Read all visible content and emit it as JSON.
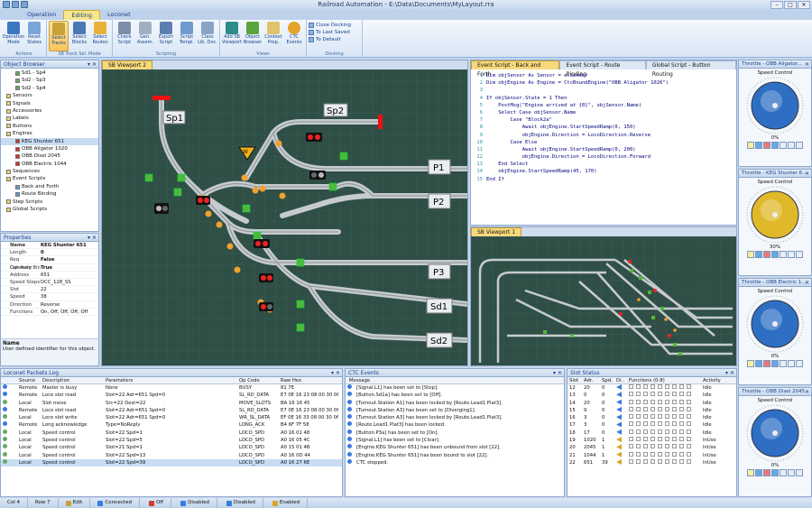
{
  "window": {
    "title": "Railroad Automation - E:\\Data\\Documents\\MyLayout.rra"
  },
  "tabs": [
    "Operation",
    "Editing",
    "Loconet"
  ],
  "ribbon": {
    "groups": [
      {
        "label": "Actions",
        "buttons": [
          {
            "l1": "Operation",
            "l2": "Mode"
          },
          {
            "l1": "Reset",
            "l2": "States"
          }
        ]
      },
      {
        "label": "SB Track Sel. Mode",
        "buttons": [
          {
            "l1": "Select",
            "l2": "Tracks"
          },
          {
            "l1": "Select",
            "l2": "Blocks"
          },
          {
            "l1": "Select",
            "l2": "Routes"
          }
        ]
      },
      {
        "label": "Scripting",
        "buttons": [
          {
            "l1": "Check",
            "l2": "Script"
          },
          {
            "l1": "Gen.",
            "l2": "Assem."
          },
          {
            "l1": "Export",
            "l2": "Script"
          },
          {
            "l1": "Script",
            "l2": "Templ."
          },
          {
            "l1": "Class",
            "l2": "Lib. Doc."
          }
        ]
      },
      {
        "label": "Views",
        "buttons": [
          {
            "l1": "Add SB",
            "l2": "Viewport"
          },
          {
            "l1": "Object",
            "l2": "Browser"
          },
          {
            "l1": "Context",
            "l2": "Prop."
          },
          {
            "l1": "CTC",
            "l2": "Events"
          }
        ]
      }
    ],
    "docking": {
      "label": "Docking",
      "items": [
        "Close Docking",
        "To Last Saved",
        "To Default"
      ]
    }
  },
  "object_browser": {
    "title": "Object Browser",
    "items": [
      "Sd1 - Sp4",
      "Sd2 - Sp3",
      "Sd2 - Sp4",
      "Sensors",
      "Signals",
      "Accessories",
      "Labels",
      "Buttons",
      "Engines",
      "KEG Shunter 651",
      "OBB Aligator 1020",
      "OBB Disel 2045",
      "OBB Electric 1044",
      "Sequences",
      "Event Scripts",
      "Back and Forth",
      "Route Binding",
      "Step Scripts",
      "Global Scripts"
    ]
  },
  "properties": {
    "title": "Properties",
    "rows": [
      {
        "k": "Name",
        "v": "KEG Shunter 651"
      },
      {
        "k": "Length",
        "v": "0"
      },
      {
        "k": "Req Catenary",
        "v": "False"
      },
      {
        "k": "Opr Auto Bin",
        "v": "True"
      },
      {
        "k": "Address",
        "v": "651"
      },
      {
        "k": "Speed Steps",
        "v": "DCC_128_SS"
      },
      {
        "k": "Slot",
        "v": "22"
      },
      {
        "k": "Speed",
        "v": "38"
      },
      {
        "k": "Direction",
        "v": "Reverse"
      },
      {
        "k": "Functions",
        "v": "On, Off, Off, Off, Off"
      }
    ],
    "desc_title": "Name",
    "desc": "User defined identifier for this object."
  },
  "viewport2": {
    "tab": "SB Viewport 2",
    "labels": [
      "Sp1",
      "Sp2",
      "P1",
      "P2",
      "P3",
      "Sd1",
      "Sd2"
    ]
  },
  "code": {
    "tabs": [
      "Event Script - Back and Forth",
      "Event Script - Route Binding",
      "Global Script - Button Routing"
    ],
    "lines": [
      "Dim objSensor As Sensor = e.Sender",
      "Dim objEngine As Engine = CtcBoundEngine(\"OBB Aligator 1020\")",
      "",
      "If objSensor.State = 1 Then",
      "    PostMsg(\"Engine arrived at {0}\", objSensor.Name)",
      "    Select Case objSensor.Name",
      "        Case \"Block2a\"",
      "            Await objEngine.StartSpeedRamp(0, 150)",
      "            objEngine.Direction = LocoDirection.Reverse",
      "        Case Else",
      "            Await objEngine.StartSpeedRamp(0, 200)",
      "            objEngine.Direction = LocoDirection.Forward",
      "    End Select",
      "    objEngine.StartSpeedRamp(45, 170)",
      "End If"
    ]
  },
  "viewport1": {
    "tab": "SB Viewport 1"
  },
  "throttles": [
    {
      "title": "Throttle - OBB Aligator...",
      "label": "Speed Control",
      "pct": "0%",
      "knob": "#2e6fc4"
    },
    {
      "title": "Throttle - KEG Shunter 6...",
      "label": "Speed Control",
      "pct": "30%",
      "knob": "#e0b92a"
    },
    {
      "title": "Throttle - OBB Electric 1...",
      "label": "Speed Control",
      "pct": "0%",
      "knob": "#2e6fc4"
    },
    {
      "title": "Throttle - OBB Disel 2045",
      "label": "Speed Control",
      "pct": "0%",
      "knob": "#2e6fc4"
    }
  ],
  "loconet_log": {
    "title": "Loconet Packets Log",
    "headers": [
      "Source",
      "Description",
      "Parameters",
      "Op Code",
      "Raw Hex"
    ],
    "rows": [
      [
        "Remote",
        "Master is busy",
        "None",
        "BUSY",
        "81 7E"
      ],
      [
        "Remote",
        "Loco slot read",
        "Slot=22 Adr=651 Spd=0",
        "SL_RD_DATA",
        "E7 0E 16 23 08 00 30 06"
      ],
      [
        "Local",
        "Slot move",
        "Src=22 Dest=22",
        "MOVE_SLOTS",
        "BA 16 16 45"
      ],
      [
        "Remote",
        "Loco slot read",
        "Slot=22 Adr=651 Spd=0",
        "SL_RD_DATA",
        "E7 0E 16 23 08 00 30 06"
      ],
      [
        "Local",
        "Loco slot write",
        "Slot=22 Adr=651 Spd=0",
        "WR_SL_DATA",
        "EF 0E 16 33 08 00 30 06"
      ],
      [
        "Remote",
        "Long acknowledge",
        "Type=NoReply",
        "LONG_ACK",
        "B4 6F 7F 58"
      ],
      [
        "Local",
        "Speed control",
        "Slot=22 Spd=1",
        "LOCO_SPD",
        "A0 16 01 48"
      ],
      [
        "Local",
        "Speed control",
        "Slot=22 Spd=5",
        "LOCO_SPD",
        "A0 16 05 4C"
      ],
      [
        "Local",
        "Speed control",
        "Slot=21 Spd=1",
        "LOCO_SPD",
        "A0 15 01 4B"
      ],
      [
        "Local",
        "Speed control",
        "Slot=22 Spd=13",
        "LOCO_SPD",
        "A0 16 0D 44"
      ],
      [
        "Local",
        "Speed control",
        "Slot=22 Spd=39",
        "LOCO_SPD",
        "A0 16 27 6E"
      ]
    ]
  },
  "ctc_events": {
    "title": "CTC Events",
    "header": "Message",
    "rows": [
      "[Signal.L1] has been set to [Stop].",
      "[Button.Sd1a] has been set to [Off].",
      "[Turnout.Station A1] has been locked by [Route.Lead1 Plat3].",
      "[Turnout.Station A3] has been set to [Diverging1].",
      "[Turnout.Station A3] has been locked by [Route.Lead1 Plat3].",
      "[Route.Lead1 Plat3] has been locked.",
      "[Button.P3a] has been set to [On].",
      "[Signal.L1] has been set to [Clear].",
      "[Engine.KEG Shunter 651] has been unbound from slot [22].",
      "[Engine.KEG Shunter 651] has been bound to slot [22].",
      "CTC stopped."
    ]
  },
  "slot_status": {
    "title": "Slot Status",
    "headers": [
      "Slot",
      "Adr.",
      "Spd.",
      "Di..",
      "Functions (0-8)",
      "Activity"
    ],
    "rows": [
      [
        "12",
        "20",
        "0",
        "Idle"
      ],
      [
        "13",
        "0",
        "0",
        "Idle"
      ],
      [
        "14",
        "20",
        "0",
        "Idle"
      ],
      [
        "15",
        "9",
        "0",
        "Idle"
      ],
      [
        "16",
        "3",
        "0",
        "Idle"
      ],
      [
        "17",
        "3",
        "0",
        "Idle"
      ],
      [
        "18",
        "17",
        "0",
        "Idle"
      ],
      [
        "19",
        "1020",
        "1",
        "InUse"
      ],
      [
        "20",
        "2045",
        "1",
        "InUse"
      ],
      [
        "21",
        "1044",
        "1",
        "InUse"
      ],
      [
        "22",
        "651",
        "39",
        "InUse"
      ]
    ]
  },
  "statusbar": {
    "col": "Col 4",
    "row": "Row 7",
    "mode": "Edit",
    "items": [
      "Connected",
      "Off",
      "Disabled",
      "Disabled",
      "Enabled"
    ],
    "colors": [
      "#3a7be0",
      "#d33b2c",
      "#3a7be0",
      "#3a7be0",
      "#d8a52a"
    ]
  }
}
